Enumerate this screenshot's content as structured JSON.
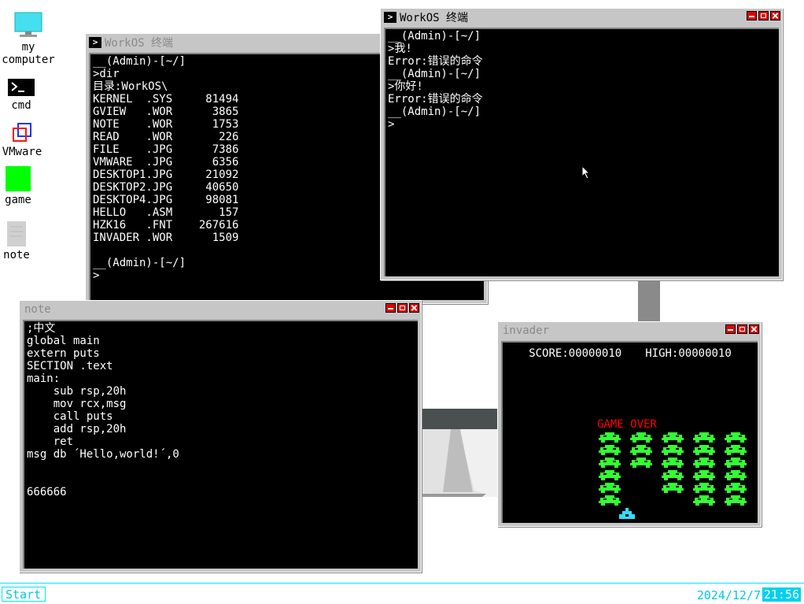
{
  "desktop": {
    "icons": [
      {
        "label": "my\ncomputer",
        "icon": "monitor-icon"
      },
      {
        "label": "cmd",
        "icon": "terminal-icon"
      },
      {
        "label": "VMware",
        "icon": "vmware-icon"
      },
      {
        "label": "game",
        "icon": "game-icon"
      },
      {
        "label": "note",
        "icon": "note-icon"
      }
    ]
  },
  "terminal_left": {
    "title": "WorkOS 终端",
    "lines": [
      "__(Admin)-[~/]",
      ">dir",
      "目录:WorkOS\\",
      "KERNEL  .SYS     81494",
      "GVIEW   .WOR      3865",
      "NOTE    .WOR      1753",
      "READ    .WOR       226",
      "FILE    .JPG      7386",
      "VMWARE  .JPG      6356",
      "DESKTOP1.JPG     21092",
      "DESKTOP2.JPG     40650",
      "DESKTOP4.JPG     98081",
      "HELLO   .ASM       157",
      "HZK16   .FNT    267616",
      "INVADER .WOR      1509",
      "",
      "__(Admin)-[~/]",
      ">"
    ]
  },
  "terminal_right": {
    "title": "WorkOS 终端",
    "lines": [
      "__(Admin)-[~/]",
      ">我!",
      "Error:错误的命令",
      "__(Admin)-[~/]",
      ">你好!",
      "Error:错误的命令",
      "__(Admin)-[~/]",
      ">"
    ]
  },
  "note": {
    "title": "note",
    "lines": [
      ";中文",
      "global main",
      "extern puts",
      "SECTION .text",
      "main:",
      "    sub rsp,20h",
      "    mov rcx,msg",
      "    call puts",
      "    add rsp,20h",
      "    ret",
      "msg db ´Hello,world!´,0",
      "",
      "",
      "666666"
    ]
  },
  "invader": {
    "title": "invader",
    "score_label": "SCORE:00000010",
    "high_label": "HIGH:00000010",
    "game_over": "GAME OVER",
    "alien_color": "#33ff33",
    "ship_color": "#33ddff",
    "alien_columns": [
      {
        "col": 0,
        "rows": [
          0,
          1,
          2,
          3,
          4,
          5
        ]
      },
      {
        "col": 1,
        "rows": [
          0,
          1,
          2
        ]
      },
      {
        "col": 2,
        "rows": [
          0,
          1,
          2,
          3,
          4
        ]
      },
      {
        "col": 3,
        "rows": [
          0,
          1,
          2,
          3,
          4,
          5
        ]
      },
      {
        "col": 4,
        "rows": [
          0,
          1,
          2,
          3,
          4,
          5
        ]
      }
    ]
  },
  "taskbar": {
    "start_label": "Start",
    "date": "2024/12/7",
    "time": "21:56"
  },
  "colors": {
    "accent": "#00e5ff",
    "window_frame": "#c6c6c6",
    "close_red": "#e00000",
    "icon_green": "#00ff00"
  }
}
